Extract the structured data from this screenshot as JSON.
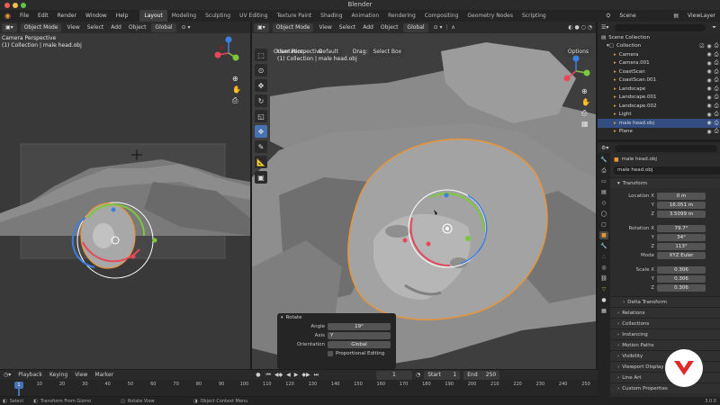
{
  "window": {
    "title": "Blender"
  },
  "menu": [
    "File",
    "Edit",
    "Render",
    "Window",
    "Help"
  ],
  "workspaces": [
    "Layout",
    "Modeling",
    "Sculpting",
    "UV Editing",
    "Texture Paint",
    "Shading",
    "Animation",
    "Rendering",
    "Compositing",
    "Geometry Nodes",
    "Scripting"
  ],
  "active_workspace": "Layout",
  "scene": {
    "name": "Scene",
    "view_layer": "ViewLayer"
  },
  "left_viewport": {
    "mode": "Object Mode",
    "menu": [
      "View",
      "Select",
      "Add",
      "Object"
    ],
    "orientation": "Global",
    "overlay_title": "Camera Perspective",
    "overlay_sub": "(1) Collection | male head.obj"
  },
  "main_viewport": {
    "mode": "Object Mode",
    "menu": [
      "View",
      "Select",
      "Add",
      "Object"
    ],
    "orientation": "Global",
    "orientation_label": "Orientation:",
    "orientation_value": "Default",
    "drag_label": "Drag:",
    "drag_value": "Select Box",
    "options": "Options",
    "overlay_title": "User Perspective",
    "overlay_sub": "(1) Collection | male head.obj"
  },
  "redo_panel": {
    "title": "Rotate",
    "angle_label": "Angle",
    "angle_value": "19°",
    "axis_label": "Axis",
    "axis_value": "Y",
    "orientation_label": "Orientation",
    "orientation_value": "Global",
    "proportional": "Proportional Editing"
  },
  "outliner": {
    "root": "Scene Collection",
    "collection": "Collection",
    "items": [
      "Camera",
      "Camera.001",
      "CoastScan",
      "CoastScan.001",
      "Landscape",
      "Landscape.001",
      "Landscape.002",
      "Light",
      "male head.obj",
      "Plane"
    ],
    "selected": "male head.obj"
  },
  "properties": {
    "object_name": "male head.obj",
    "object_field": "male head.obj",
    "transform_title": "Transform",
    "location_label": "Location X",
    "location": [
      "0 m",
      "16.051 m",
      "3.5099 m"
    ],
    "rotation_label": "Rotation X",
    "rotation": [
      "79.7°",
      "34°",
      "113°"
    ],
    "mode_label": "Mode",
    "mode_value": "XYZ Euler",
    "scale_label": "Scale X",
    "scale": [
      "0.306",
      "0.306",
      "0.306"
    ],
    "axis_y": "Y",
    "axis_z": "Z",
    "delta": "Delta Transform",
    "sections": [
      "Relations",
      "Collections",
      "Instancing",
      "Motion Paths",
      "Visibility",
      "Viewport Display",
      "Line Art",
      "Custom Properties"
    ]
  },
  "timeline": {
    "menu": [
      "Playback",
      "Keying",
      "View",
      "Marker"
    ],
    "current_frame": "1",
    "start_label": "Start",
    "start_value": "1",
    "end_label": "End",
    "end_value": "250",
    "ticks": [
      "1",
      "10",
      "20",
      "30",
      "40",
      "50",
      "60",
      "70",
      "80",
      "90",
      "100",
      "110",
      "120",
      "130",
      "140",
      "150",
      "160",
      "170",
      "180",
      "190",
      "200",
      "210",
      "220",
      "230",
      "240",
      "250"
    ],
    "playhead": "1"
  },
  "status": {
    "select": "Select",
    "transform": "Transform From Gizmo",
    "rotate": "Rotate View",
    "context": "Object Context Menu",
    "version": "3.0.0"
  },
  "colors": {
    "accent": "#4772b3",
    "selection": "#e8953a",
    "x_axis": "#e8475a",
    "y_axis": "#7bc93a",
    "z_axis": "#3d7fe0"
  }
}
